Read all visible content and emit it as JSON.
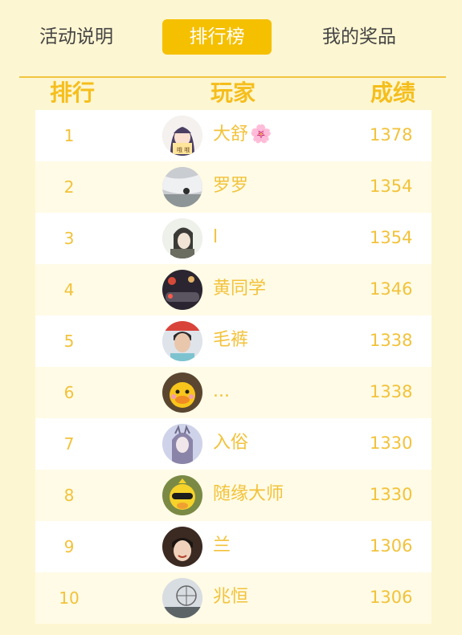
{
  "tabs": [
    {
      "label": "活动说明",
      "active": false
    },
    {
      "label": "排行榜",
      "active": true
    },
    {
      "label": "我的奖品",
      "active": false
    }
  ],
  "table": {
    "headers": {
      "rank": "排行",
      "player": "玩家",
      "score": "成绩"
    },
    "rows": [
      {
        "rank": "1",
        "name": "大舒",
        "score": "1378",
        "avatar": "cartoon-girl-avatar",
        "flower": "🌸"
      },
      {
        "rank": "2",
        "name": "罗罗",
        "score": "1354",
        "avatar": "waterfall-photo-avatar"
      },
      {
        "rank": "3",
        "name": "l",
        "score": "1354",
        "avatar": "anime-boy-avatar"
      },
      {
        "rank": "4",
        "name": "黄同学",
        "score": "1346",
        "avatar": "night-car-avatar"
      },
      {
        "rank": "5",
        "name": "毛裤",
        "score": "1338",
        "avatar": "young-man-avatar"
      },
      {
        "rank": "6",
        "name": "...",
        "score": "1338",
        "avatar": "yellow-duck-avatar"
      },
      {
        "rank": "7",
        "name": "入俗",
        "score": "1330",
        "avatar": "fantasy-girl-avatar"
      },
      {
        "rank": "8",
        "name": "随缘大师",
        "score": "1330",
        "avatar": "cartoon-duck-glasses-avatar"
      },
      {
        "rank": "9",
        "name": "兰",
        "score": "1306",
        "avatar": "boy-photo-avatar"
      },
      {
        "rank": "10",
        "name": "兆恒",
        "score": "1306",
        "avatar": "ferris-wheel-avatar"
      }
    ]
  },
  "colors": {
    "accent": "#f5c000",
    "text": "#f2c23a",
    "background": "#fdf6d2"
  }
}
